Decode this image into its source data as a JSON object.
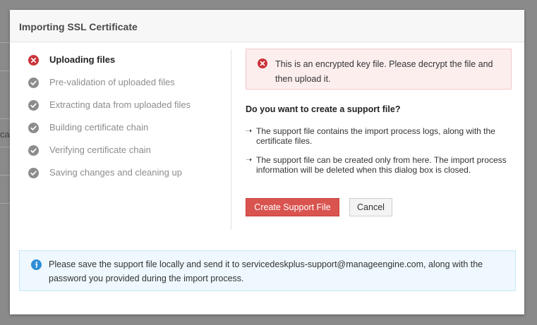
{
  "backdrop": {
    "partial_text": "ca"
  },
  "dialog": {
    "title": "Importing SSL Certificate"
  },
  "steps": [
    {
      "label": "Uploading files",
      "status": "error"
    },
    {
      "label": "Pre-validation of uploaded files",
      "status": "done"
    },
    {
      "label": "Extracting data from uploaded files",
      "status": "done"
    },
    {
      "label": "Building certificate chain",
      "status": "done"
    },
    {
      "label": "Verifying certificate chain",
      "status": "done"
    },
    {
      "label": "Saving changes and cleaning up",
      "status": "done"
    }
  ],
  "error": {
    "message": "This is an encrypted key file. Please decrypt the file and then upload it."
  },
  "support": {
    "question": "Do you want to create a support file?",
    "notes": [
      "The support file contains the import process logs, along with the certificate files.",
      "The support file can be created only from here. The import process information will be deleted when this dialog box is closed."
    ],
    "arrow_glyph": "➝"
  },
  "buttons": {
    "create_support": "Create Support File",
    "cancel": "Cancel"
  },
  "info": {
    "message": "Please save the support file locally and send it to servicedeskplus-support@manageengine.com, along with the password you provided during the import process."
  },
  "colors": {
    "error": "#c9343a",
    "done": "#8c8c8c",
    "primary_button": "#d9534f",
    "info_icon": "#2f8fd6"
  }
}
